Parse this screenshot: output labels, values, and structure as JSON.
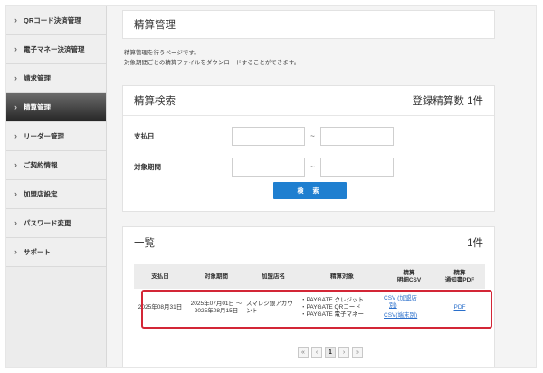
{
  "sidebar": {
    "items": [
      {
        "label": "QRコード決済管理",
        "active": false
      },
      {
        "label": "電子マネー決済管理",
        "active": false
      },
      {
        "label": "請求管理",
        "active": false
      },
      {
        "label": "精算管理",
        "active": true
      },
      {
        "label": "リーダー管理",
        "active": false
      },
      {
        "label": "ご契約情報",
        "active": false
      },
      {
        "label": "加盟店設定",
        "active": false
      },
      {
        "label": "パスワード変更",
        "active": false
      },
      {
        "label": "サポート",
        "active": false
      }
    ],
    "chevron": "›"
  },
  "page": {
    "title": "精算管理",
    "description_line1": "精算管理を行うページです。",
    "description_line2": "対象期間ごとの精算ファイルをダウンロードすることができます。"
  },
  "search": {
    "title": "精算検索",
    "count_label": "登録精算数 1件",
    "payment_date_label": "支払日",
    "target_period_label": "対象期間",
    "tilde": "~",
    "button_label": "検 索"
  },
  "list": {
    "title": "一覧",
    "count_label": "1件",
    "headers": {
      "payment_date": "支払日",
      "target_period": "対象期間",
      "store_name": "加盟店名",
      "target": "精算対象",
      "csv_line1": "精算",
      "csv_line2": "明細CSV",
      "pdf_line1": "精算",
      "pdf_line2": "通知書PDF"
    },
    "row": {
      "payment_date": "2025年08月31日",
      "period_line1": "2025年07月01日 ～",
      "period_line2": "2025年08月15日",
      "store_line1": "スマレジ銀アカウ",
      "store_line2": "ント",
      "target_line1": "・PAYGATE クレジット",
      "target_line2": "・PAYGATE QRコード",
      "target_line3": "・PAYGATE 電子マネー",
      "csv_link1_line1": "CSV (加盟店",
      "csv_link1_line2": "別)",
      "csv_link2": "CSV(端末別)",
      "pdf_link": "PDF"
    }
  },
  "pager": {
    "first": "«",
    "prev": "‹",
    "current": "1",
    "next": "›",
    "last": "»"
  },
  "colors": {
    "accent": "#1f7fd0",
    "highlight": "#d32636",
    "link": "#2a6fcb"
  }
}
